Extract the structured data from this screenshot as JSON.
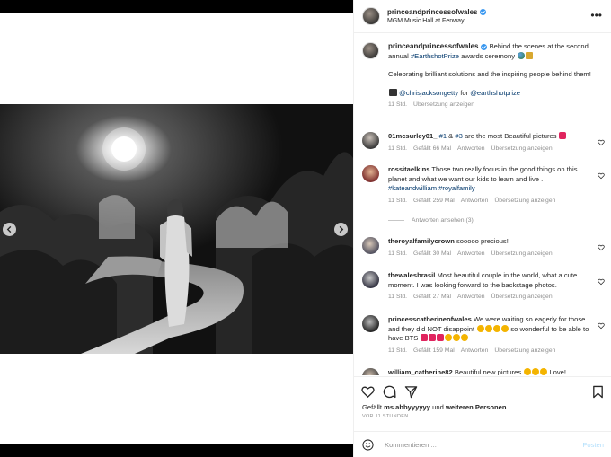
{
  "post": {
    "username": "princeandprincessofwales",
    "location": "MGM Music Hall at Fenway"
  },
  "caption": {
    "text_1": "Behind the scenes at the second annual",
    "hashtag": "#EarthshotPrize",
    "text_2": "awards ceremony",
    "line2": "Celebrating brilliant solutions and the inspiring people behind them!",
    "credit_mention": "@chrisjacksongetty",
    "credit_for": "for",
    "credit_target": "@earthshotprize",
    "time": "11 Std.",
    "translate": "Übersetzung anzeigen"
  },
  "comments": [
    {
      "user": "01mcsurley01_",
      "parts": [
        "#1",
        "&",
        "#3",
        "are the most Beautiful pictures"
      ],
      "time": "11 Std.",
      "likes": "Gefällt 66 Mal",
      "reply": "Antworten",
      "translate": "Übersetzung anzeigen"
    },
    {
      "user": "rossitaelkins",
      "text": "Those two really focus in the good things on this planet and what we want our kids to learn and live .",
      "tags": "#kateandwilliam #royalfamily",
      "time": "11 Std.",
      "likes": "Gefällt 259 Mal",
      "reply": "Antworten",
      "translate": "Übersetzung anzeigen",
      "view_replies": "Antworten ansehen (3)"
    },
    {
      "user": "theroyalfamilycrown",
      "text": "sooooo precious!",
      "time": "11 Std.",
      "likes": "Gefällt 30 Mal",
      "reply": "Antworten",
      "translate": "Übersetzung anzeigen"
    },
    {
      "user": "thewalesbrasil",
      "text": "Most beautiful couple in the world, what a cute moment. I was looking forward to the backstage photos.",
      "time": "11 Std.",
      "likes": "Gefällt 27 Mal",
      "reply": "Antworten",
      "translate": "Übersetzung anzeigen"
    },
    {
      "user": "princesscatherineofwales",
      "text_1": "We were waiting so eagerly for those and they did NOT disappoint",
      "text_2": "so wonderful to be able to have BTS",
      "time": "11 Std.",
      "likes": "Gefällt 159 Mal",
      "reply": "Antworten",
      "translate": "Übersetzung anzeigen"
    },
    {
      "user": "william_catherine82",
      "text": "Beautiful new pictures",
      "text_tail": "Love!"
    }
  ],
  "footer": {
    "likes_prefix": "Gefällt",
    "likes_user": "ms.abbyyyyyy",
    "likes_mid": "und",
    "likes_others": "weiteren Personen",
    "ago": "VOR 11 STUNDEN",
    "comment_placeholder": "Kommentieren ...",
    "post_button": "Posten"
  },
  "colors": {
    "link": "#00376b",
    "heart_red": "#ed4956",
    "verified_blue": "#3897f0",
    "post_disabled": "#b2dffc"
  }
}
